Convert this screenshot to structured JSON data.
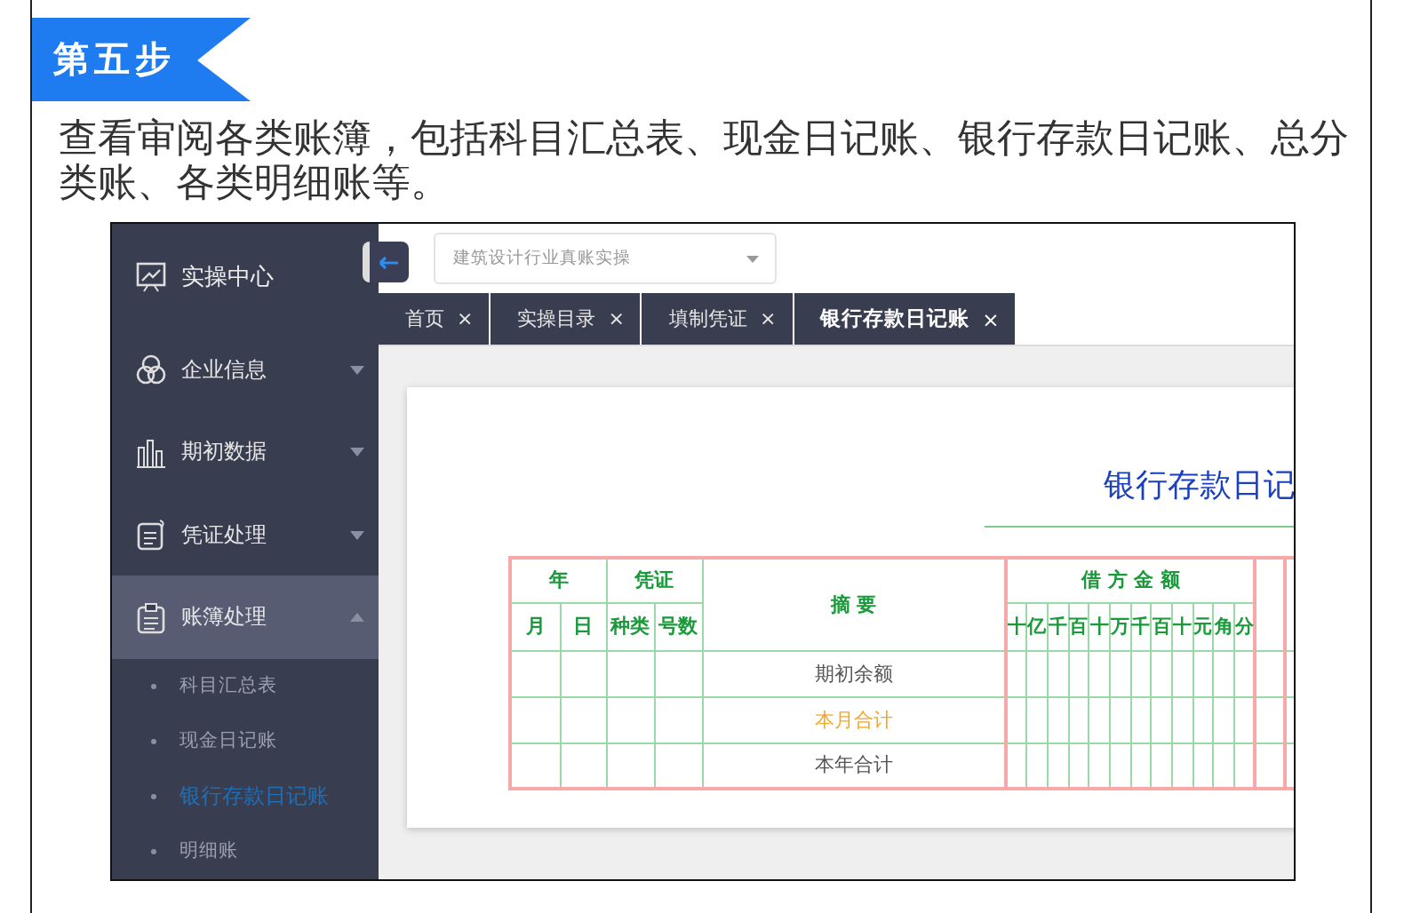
{
  "step_badge": "第五步",
  "description": "查看审阅各类账簿，包括科目汇总表、现金日记账、银行存款日记账、总分类账、各类明细账等。",
  "app": {
    "sidebar": {
      "items": [
        {
          "kind": "header",
          "label": "实操中心"
        },
        {
          "kind": "menu",
          "label": "企业信息",
          "expanded": false
        },
        {
          "kind": "menu",
          "label": "期初数据",
          "expanded": false
        },
        {
          "kind": "menu",
          "label": "凭证处理",
          "expanded": false
        },
        {
          "kind": "menu",
          "label": "账簿处理",
          "expanded": true,
          "children": [
            {
              "label": "科目汇总表",
              "selected": false
            },
            {
              "label": "现金日记账",
              "selected": false
            },
            {
              "label": "银行存款日记账",
              "selected": true
            },
            {
              "label": "明细账",
              "selected": false
            }
          ]
        }
      ]
    },
    "course_select": {
      "placeholder": "建筑设计行业真账实操"
    },
    "tabs": [
      {
        "label": "首页",
        "close": "×",
        "selected": false
      },
      {
        "label": "实操目录",
        "close": "×",
        "selected": false
      },
      {
        "label": "填制凭证",
        "close": "×",
        "selected": false
      },
      {
        "label": "银行存款日记账",
        "close": "×",
        "selected": true
      }
    ],
    "ledger": {
      "title": "银行存款日记",
      "header_groups": [
        {
          "label": "年"
        },
        {
          "label": "凭证"
        },
        {
          "label": "摘 要"
        },
        {
          "label": "借 方 金 额"
        }
      ],
      "sub_headers": [
        "月",
        "日",
        "种类",
        "号数"
      ],
      "digit_labels": [
        "十",
        "亿",
        "千",
        "百",
        "十",
        "万",
        "千",
        "百",
        "十",
        "元",
        "角",
        "分"
      ],
      "rows": [
        {
          "summary": "期初余额",
          "color": "#555555"
        },
        {
          "summary": "本月合计",
          "color": "#f5a623"
        },
        {
          "summary": "本年合计",
          "color": "#555555"
        }
      ]
    }
  }
}
